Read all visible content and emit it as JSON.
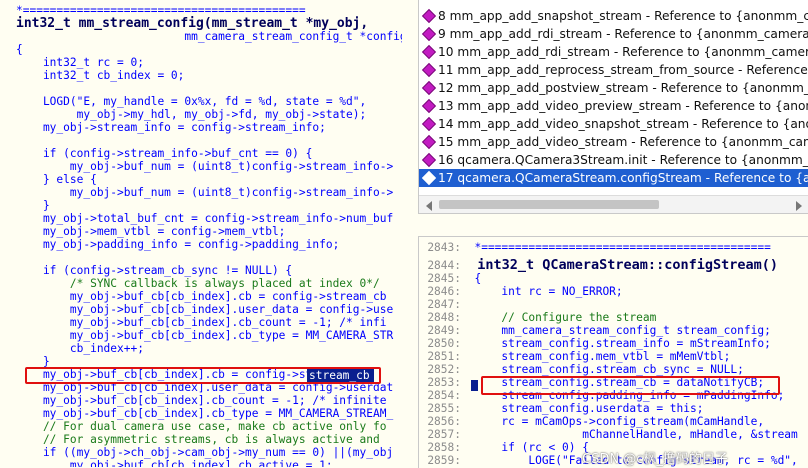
{
  "left_code": {
    "lines": [
      "*==========================================",
      "int32_t mm_stream_config(mm_stream_t *my_obj,",
      "                         mm_camera_stream_config_t *config)",
      "{",
      "    int32_t rc = 0;",
      "    int32_t cb_index = 0;",
      "",
      "    LOGD(\"E, my_handle = 0x%x, fd = %d, state = %d\",",
      "         my_obj->my_hdl, my_obj->fd, my_obj->state);",
      "    my_obj->stream_info = config->stream_info;",
      "",
      "    if (config->stream_info->buf_cnt == 0) {",
      "        my_obj->buf_num = (uint8_t)config->stream_info->",
      "    } else {",
      "        my_obj->buf_num = (uint8_t)config->stream_info->",
      "    }",
      "    my_obj->total_buf_cnt = config->stream_info->num_buf",
      "    my_obj->mem_vtbl = config->mem_vtbl;",
      "    my_obj->padding_info = config->padding_info;",
      "",
      "    if (config->stream_cb_sync != NULL) {",
      "        /* SYNC callback is always placed at index 0*/",
      "        my_obj->buf_cb[cb_index].cb = config->stream_cb",
      "        my_obj->buf_cb[cb_index].user_data = config->use",
      "        my_obj->buf_cb[cb_index].cb_count = -1; /* infi",
      "        my_obj->buf_cb[cb_index].cb_type = MM_CAMERA_STR",
      "        cb_index++;",
      "    }",
      "    my_obj->buf_cb[cb_index].cb = config->stream_cb;",
      "    my_obj->buf_cb[cb_index].user_data = config->userdat",
      "    my_obj->buf_cb[cb_index].cb_count = -1; /* infinite",
      "    my_obj->buf_cb[cb_index].cb_type = MM_CAMERA_STREAM_",
      "    // For dual camera use case, make cb active only fo",
      "    // For asymmetric streams, cb is always active and ",
      "    if ((my_obj->ch_obj->cam_obj->my_num == 0) ||(my_obj",
      "        my_obj->buf_cb[cb_index].cb_active = 1;"
    ],
    "selected_text": "stream_cb"
  },
  "references": {
    "items": [
      "8 mm_app_add_snapshot_stream - Reference to {anonmm_came",
      "9 mm_app_add_rdi_stream - Reference to {anonmm_camera_stre",
      "10 mm_app_add_rdi_stream - Reference to {anonmm_camera_s",
      "11 mm_app_add_reprocess_stream_from_source - Reference to",
      "12 mm_app_add_postview_stream - Reference to {anonmm_came",
      "13 mm_app_add_video_preview_stream - Reference to {anonmm",
      "14 mm_app_add_video_snapshot_stream - Reference to {anonmm",
      "15 mm_app_add_video_stream - Reference to {anonmm_camera",
      "16 qcamera.QCamera3Stream.init - Reference to {anonmm_cam",
      "17 qcamera.QCameraStream.configStream - Reference to {anon"
    ],
    "selected_index": 9
  },
  "right_code": {
    "lines": [
      {
        "num": "2843:",
        "text": "  *==========================================="
      },
      {
        "num": "2844:",
        "text": "  int32_t QCameraStream::configStream()"
      },
      {
        "num": "2845:",
        "text": "  {"
      },
      {
        "num": "2846:",
        "text": "      int rc = NO_ERROR;"
      },
      {
        "num": "2847:",
        "text": ""
      },
      {
        "num": "2848:",
        "text": "      // Configure the stream"
      },
      {
        "num": "2849:",
        "text": "      mm_camera_stream_config_t stream_config;"
      },
      {
        "num": "2850:",
        "text": "      stream_config.stream_info = mStreamInfo;"
      },
      {
        "num": "2851:",
        "text": "      stream_config.mem_vtbl = mMemVtbl;"
      },
      {
        "num": "2852:",
        "text": "      stream_config.stream_cb_sync = NULL;"
      },
      {
        "num": "2853:",
        "text": "      stream_config.stream_cb = dataNotifyCB;"
      },
      {
        "num": "2854:",
        "text": "      stream_config.padding_info = mPaddingInfo;"
      },
      {
        "num": "2855:",
        "text": "      stream_config.userdata = this;"
      },
      {
        "num": "2856:",
        "text": "      rc = mCamOps->config_stream(mCamHandle,"
      },
      {
        "num": "2857:",
        "text": "                  mChannelHandle, mHandle, &stream"
      },
      {
        "num": "2858:",
        "text": "      if (rc < 0) {"
      },
      {
        "num": "2859:",
        "text": "          LOGE(\"Failed to config stream, rc = %d\","
      }
    ]
  },
  "watermark": "CSDN @c枫_撸码的日子",
  "colors": {
    "code": "#0000ff",
    "selection": "#0a1f8f",
    "highlight_box": "#e01010",
    "list_selected": "#1f5fd1",
    "bullet": "#c21bc2"
  }
}
